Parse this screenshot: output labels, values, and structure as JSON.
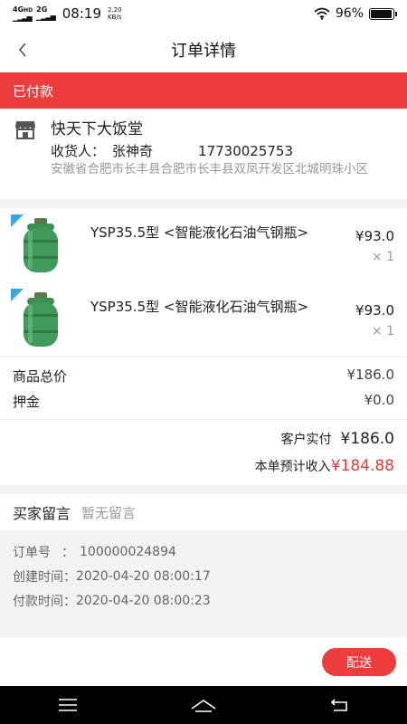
{
  "status_bar": {
    "network_a": "4G",
    "network_a_sub": "HD",
    "network_b": "2G",
    "time": "08:19",
    "speed_value": "2.20",
    "speed_unit": "KB/s",
    "battery": "96%",
    "battery_level": 0.96
  },
  "nav": {
    "title": "订单详情",
    "back_icon": "chevron-left-icon"
  },
  "banner": {
    "status": "已付款",
    "color": "#ee3d3d"
  },
  "shop": {
    "icon": "store-icon",
    "name": "快天下大饭堂",
    "receiver_label": "收货人：",
    "receiver_name": "张神奇",
    "phone": "17730025753",
    "address": "安徽省合肥市长丰县合肥市长丰县双凤开发区北城明珠小区"
  },
  "goods": [
    {
      "name": "YSP35.5型 <智能液化石油气钢瓶>",
      "price": "¥93.0",
      "qty": "× 1",
      "image": "gas-cylinder-image"
    },
    {
      "name": "YSP35.5型 <智能液化石油气钢瓶>",
      "price": "¥93.0",
      "qty": "× 1",
      "image": "gas-cylinder-image"
    }
  ],
  "summary": {
    "goods_total_label": "商品总价",
    "goods_total": "¥186.0",
    "deposit_label": "押金",
    "deposit": "¥0.0",
    "paid_label": "客户实付",
    "paid": "¥186.0",
    "expected_label": "本单预计收入",
    "expected": "¥184.88",
    "accent": "#e23b3b"
  },
  "message": {
    "label": "买家留言",
    "value": "暂无留言"
  },
  "order_info": {
    "order_no_label": "订单号",
    "order_no_sep": "：",
    "order_no": "100000024894",
    "created_label": "创建时间：",
    "created": "2020-04-20 08:00:17",
    "paid_label": "付款时间：",
    "paid": "2020-04-20 08:00:23"
  },
  "actions": {
    "deliver": "配送"
  },
  "system_nav": {
    "menu_icon": "menu-icon",
    "home_icon": "home-icon",
    "back_icon": "back-arrow-icon"
  }
}
